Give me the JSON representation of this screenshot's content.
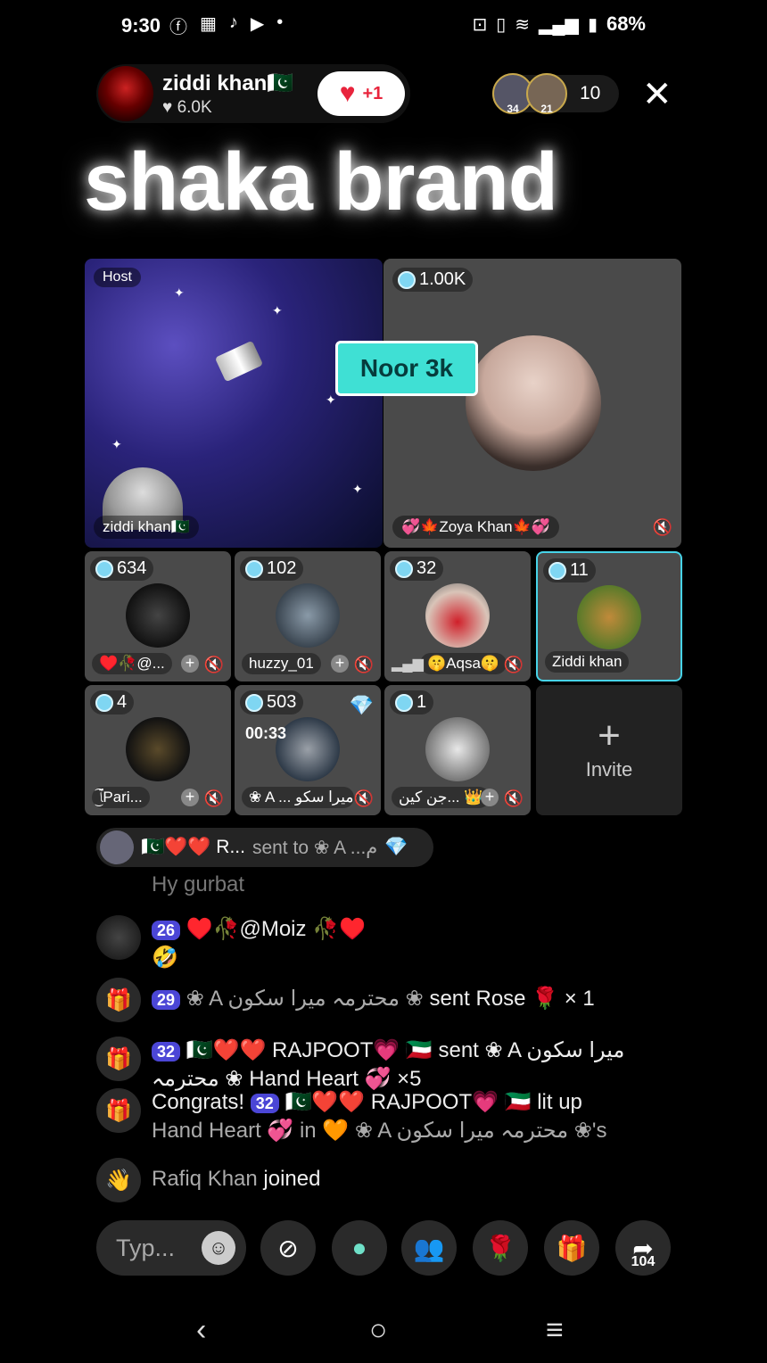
{
  "status": {
    "time": "9:30",
    "battery": "68%"
  },
  "header": {
    "host_name": "ziddi khan🇵🇰",
    "host_likes": "6.0K",
    "follow_plus": "+1",
    "viewer_badges": [
      "34",
      "21"
    ],
    "viewer_count": "10"
  },
  "room": {
    "title": "shaka brand"
  },
  "big_seats": {
    "host": {
      "tag": "Host",
      "name": "ziddi khan🇵🇰"
    },
    "zoya": {
      "coins": "1.00K",
      "name": "💞🍁Zoya Khan🍁💞",
      "badge": "Noor 3k"
    }
  },
  "seats": [
    {
      "coins": "634",
      "name": "♥️🥀@..."
    },
    {
      "coins": "102",
      "name": "huzzy_01"
    },
    {
      "coins": "32",
      "name": "🤫Aqsa🤫"
    },
    {
      "coins": "11",
      "name": "Ziddi khan"
    },
    {
      "coins": "4",
      "name": "ﭑ͜͡Pari..."
    },
    {
      "coins": "503",
      "name": "❀ A ... میرا سکو",
      "timer": "00:33"
    },
    {
      "coins": "1",
      "name": "جن کین... 👑"
    }
  ],
  "invite": {
    "label": "Invite"
  },
  "chat": {
    "gift_banner": {
      "sender": "🇵🇰❤️❤️ R...",
      "text": "sent to ❀ A ...م"
    },
    "faded_msg": "Hy gurbat",
    "msg1": {
      "badge": "26",
      "text": "♥️🥀@Moiz 🥀♥️",
      "emoji": "🤣"
    },
    "msg2": {
      "badge": "29",
      "pre": "❀ A محترمہ میرا سکون ❀",
      "text": "sent Rose 🌹 × 1"
    },
    "msg3": {
      "badge": "32",
      "pre": "🇵🇰❤️❤️ RAJPOOT💗 🇰🇼 sent ❀ A میرا سکون",
      "line2": "محترمہ ❀ Hand Heart 💞 ×5"
    },
    "msg4": {
      "lead": "Congrats!",
      "badge": "32",
      "pre": "🇵🇰❤️❤️ RAJPOOT💗 🇰🇼 lit up",
      "line2": "Hand Heart 💞 in 🧡 ❀ A محترمہ میرا سکون ❀'s"
    },
    "join": {
      "name": "Rafiq Khan",
      "text": "joined"
    }
  },
  "input_bar": {
    "placeholder": "Typ...",
    "share_count": "104"
  }
}
